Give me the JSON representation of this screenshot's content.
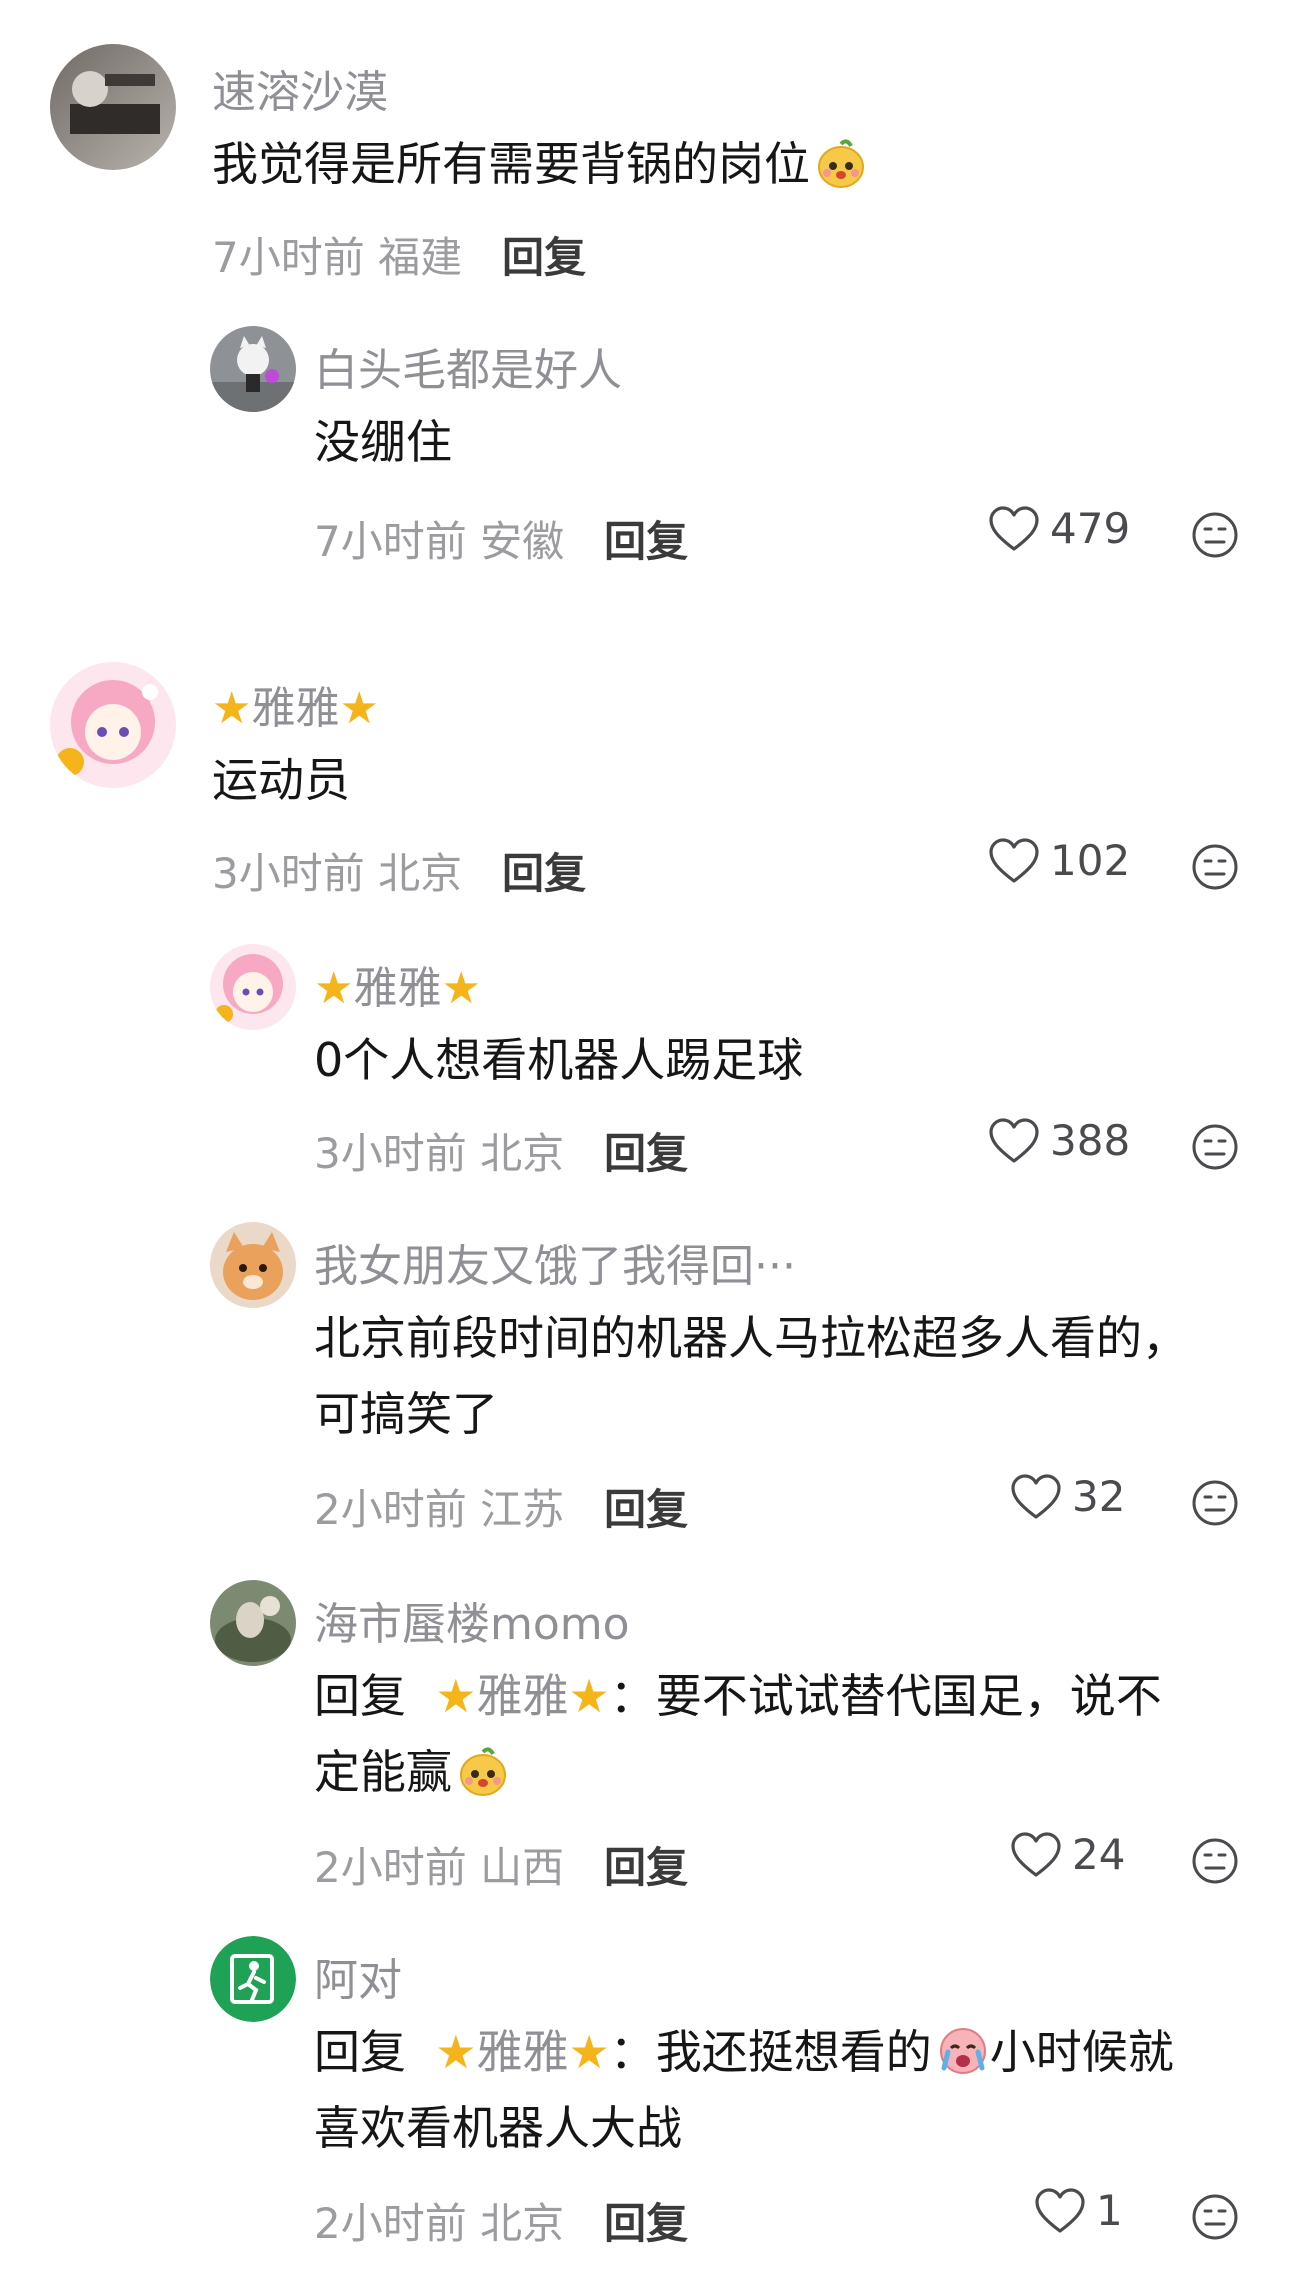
{
  "comments": [
    {
      "username": "速溶沙漠",
      "text": "我觉得是所有需要背锅的岗位",
      "time": "7小时前",
      "location": "福建",
      "reply_label": "回复"
    },
    {
      "username": "白头毛都是好人",
      "text": "没绷住",
      "time": "7小时前",
      "location": "安徽",
      "reply_label": "回复",
      "likes": "479"
    },
    {
      "username": "雅雅",
      "text": "运动员",
      "time": "3小时前",
      "location": "北京",
      "reply_label": "回复",
      "likes": "102"
    },
    {
      "username": "雅雅",
      "text": "0个人想看机器人踢足球",
      "time": "3小时前",
      "location": "北京",
      "reply_label": "回复",
      "likes": "388"
    },
    {
      "username": "我女朋友又饿了我得回···",
      "text_line1": "北京前段时间的机器人马拉松超多人看的，",
      "text_line2": "可搞笑了",
      "time": "2小时前",
      "location": "江苏",
      "reply_label": "回复",
      "likes": "32"
    },
    {
      "username": "海市蜃楼momo",
      "reply_prefix": "回复",
      "reply_to": "雅雅",
      "text_line1": "：要不试试替代国足，说不",
      "text_line2": "定能赢",
      "time": "2小时前",
      "location": "山西",
      "reply_label": "回复",
      "likes": "24"
    },
    {
      "username": "阿对",
      "reply_prefix": "回复",
      "reply_to": "雅雅",
      "text_line1a": "：我还挺想看的",
      "text_line1b": "小时候就",
      "text_line2": "喜欢看机器人大战",
      "time": "2小时前",
      "location": "北京",
      "reply_label": "回复",
      "likes": "1"
    }
  ],
  "star_glyph": "★",
  "colors": {
    "name_gray": "#8f8f95",
    "meta_gray": "#9b9ba0",
    "star_yellow": "#f4b41a",
    "exit_green": "#1fa255"
  }
}
